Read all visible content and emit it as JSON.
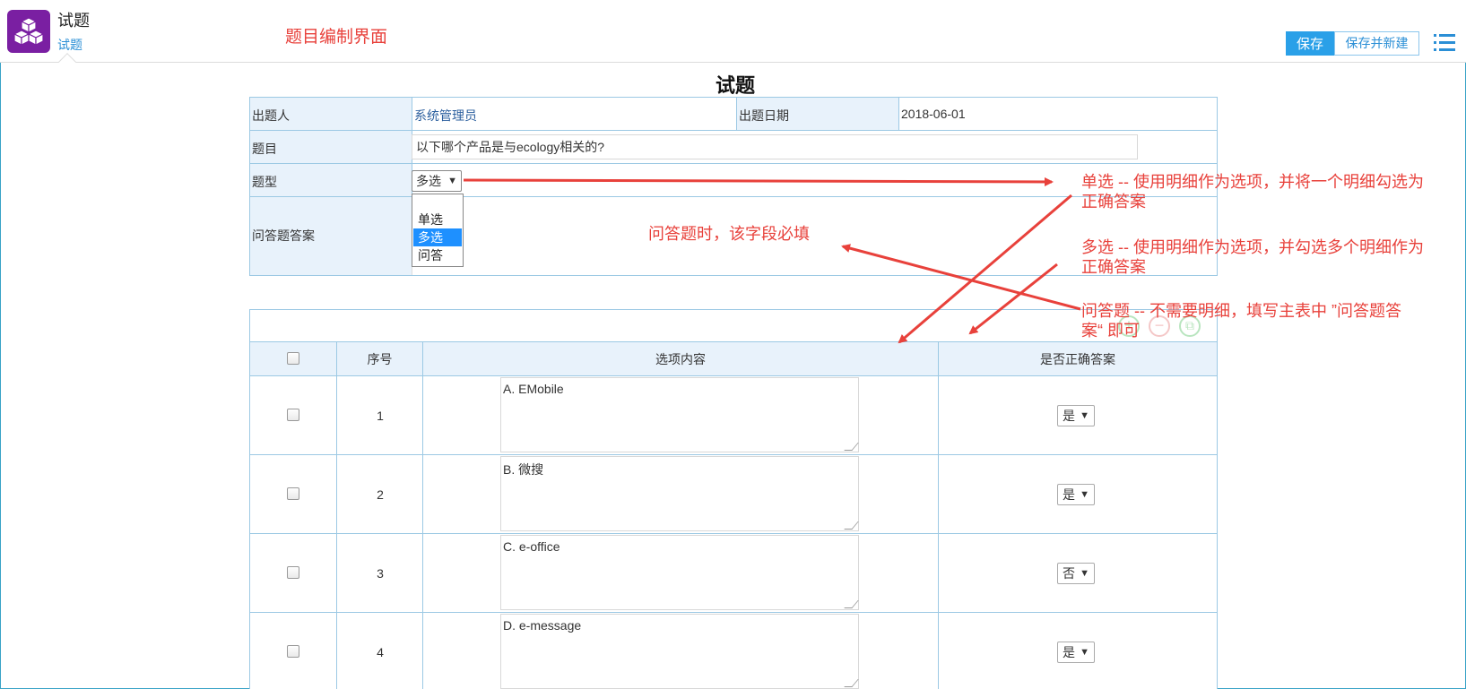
{
  "header": {
    "app_title": "试题",
    "app_sub": "试题",
    "note": "题目编制界面",
    "save_label": "保存",
    "save_new_label": "保存并新建"
  },
  "form": {
    "title": "试题",
    "author_label": "出题人",
    "author_value": "系统管理员",
    "date_label": "出题日期",
    "date_value": "2018-06-01",
    "question_label": "题目",
    "question_value": "以下哪个产品是与ecology相关的?",
    "type_label": "题型",
    "type_value": "多选",
    "type_options": [
      "单选",
      "多选",
      "问答"
    ],
    "answer_label": "问答题答案"
  },
  "detail": {
    "headers": {
      "seq": "序号",
      "content": "选项内容",
      "correct": "是否正确答案"
    },
    "rows": [
      {
        "seq": "1",
        "content": "A. EMobile",
        "correct": "是"
      },
      {
        "seq": "2",
        "content": "B. 微搜",
        "correct": "是"
      },
      {
        "seq": "3",
        "content": "C. e-office",
        "correct": "否"
      },
      {
        "seq": "4",
        "content": "D. e-message",
        "correct": "是"
      }
    ]
  },
  "annotations": {
    "single_line1": "单选 -- 使用明细作为选项，并将一个明细勾选为",
    "single_line2": "正确答案",
    "multi_line1": "多选 -- 使用明细作为选项，并勾选多个明细作为",
    "multi_line2": "正确答案",
    "qa_line1": "问答题 -- 不需要明细，填写主表中 ”问答题答",
    "qa_line2": "案“ 即可",
    "required_note": "问答题时，该字段必填"
  },
  "colors": {
    "accent": "#2aa0e8",
    "annotation": "#e8413b",
    "border": "#9cc9e4",
    "label_bg": "#e8f2fb",
    "logo": "#7a1fa2"
  }
}
